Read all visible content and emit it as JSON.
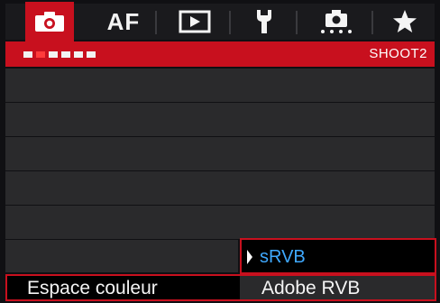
{
  "tabs": [
    {
      "name": "camera-icon",
      "active": true
    },
    {
      "label": "AF"
    },
    {
      "name": "play-icon"
    },
    {
      "name": "wrench-icon"
    },
    {
      "name": "custom-function-icon"
    },
    {
      "name": "star-icon"
    }
  ],
  "submenu": {
    "page_label": "SHOOT2",
    "page_count": 6,
    "current_page": 2
  },
  "popup": {
    "options": [
      "sRVB",
      "Adobe RVB"
    ],
    "highlighted": "sRVB"
  },
  "selected_item": {
    "label": "Espace couleur",
    "value": "Adobe RVB"
  },
  "colors": {
    "accent": "#c8101e",
    "highlight_text": "#3fa9ff",
    "text": "#f4f4f4"
  }
}
